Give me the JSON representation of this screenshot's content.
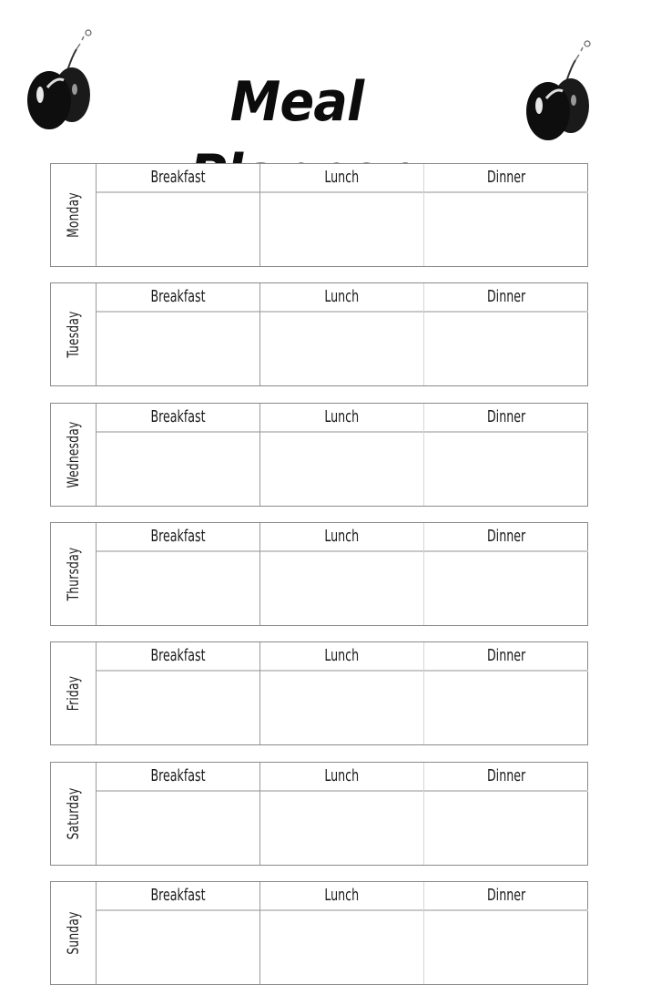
{
  "header": {
    "title": "Meal Planner",
    "decorations": [
      "apple-icon",
      "apple-icon"
    ]
  },
  "meals": [
    "Breakfast",
    "Lunch",
    "Dinner"
  ],
  "days": [
    {
      "name": "Monday",
      "breakfast": "",
      "lunch": "",
      "dinner": ""
    },
    {
      "name": "Tuesday",
      "breakfast": "",
      "lunch": "",
      "dinner": ""
    },
    {
      "name": "Wednesday",
      "breakfast": "",
      "lunch": "",
      "dinner": ""
    },
    {
      "name": "Thursday",
      "breakfast": "",
      "lunch": "",
      "dinner": ""
    },
    {
      "name": "Friday",
      "breakfast": "",
      "lunch": "",
      "dinner": ""
    },
    {
      "name": "Saturday",
      "breakfast": "",
      "lunch": "",
      "dinner": ""
    },
    {
      "name": "Sunday",
      "breakfast": "",
      "lunch": "",
      "dinner": ""
    }
  ]
}
